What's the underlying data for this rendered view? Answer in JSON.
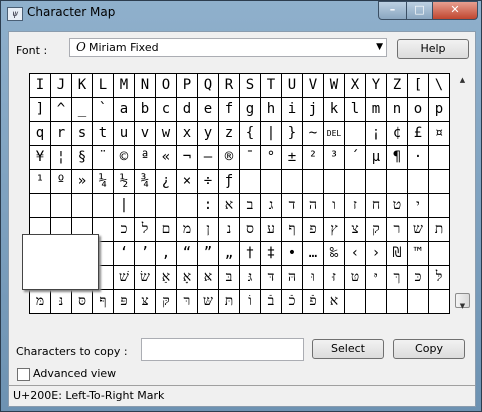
{
  "window": {
    "title": "Character Map",
    "app_icon_glyph": "ψ"
  },
  "title_buttons": {
    "minimize": "–",
    "maximize": "□",
    "close": "✕"
  },
  "font": {
    "label": "Font :",
    "glyph": "O",
    "value": "Miriam Fixed",
    "arrow": "▼"
  },
  "buttons": {
    "help": "Help",
    "select": "Select",
    "copy": "Copy"
  },
  "grid_rows": [
    [
      "I",
      "J",
      "K",
      "L",
      "M",
      "N",
      "O",
      "P",
      "Q",
      "R",
      "S",
      "T",
      "U",
      "V",
      "W",
      "X",
      "Y",
      "Z",
      "[",
      "\\"
    ],
    [
      "]",
      "^",
      "_",
      "`",
      "a",
      "b",
      "c",
      "d",
      "e",
      "f",
      "g",
      "h",
      "i",
      "j",
      "k",
      "l",
      "m",
      "n",
      "o",
      "p"
    ],
    [
      "q",
      "r",
      "s",
      "t",
      "u",
      "v",
      "w",
      "x",
      "y",
      "z",
      "{",
      "|",
      "}",
      "~",
      "DEL",
      "",
      "¡",
      "¢",
      "£",
      "¤"
    ],
    [
      "¥",
      "¦",
      "§",
      "¨",
      "©",
      "ª",
      "«",
      "¬",
      "–",
      "®",
      "¯",
      "°",
      "±",
      "²",
      "³",
      "´",
      "µ",
      "¶",
      "·",
      ""
    ],
    [
      "¹",
      "º",
      "»",
      "¼",
      "½",
      "¾",
      "¿",
      "×",
      "÷",
      "ƒ",
      "",
      "",
      "",
      "",
      "",
      "",
      "",
      "",
      "",
      ""
    ],
    [
      "",
      "",
      "",
      "",
      "|",
      "",
      "",
      "",
      ":",
      "א",
      "ב",
      "ג",
      "ד",
      "ה",
      "ו",
      "ז",
      "ח",
      "ט",
      "י",
      ""
    ],
    [
      "",
      "",
      "",
      "",
      "כ",
      "ל",
      "ם",
      "מ",
      "ן",
      "נ",
      "ס",
      "ע",
      "ף",
      "פ",
      "ץ",
      "צ",
      "ק",
      "ר",
      "ש",
      "ת"
    ],
    [
      "",
      "",
      "",
      "",
      "‘",
      "’",
      "‚",
      "“",
      "”",
      "„",
      "†",
      "‡",
      "•",
      "…",
      "‰",
      "‹",
      "›",
      "₪",
      "™",
      ""
    ],
    [
      "",
      "",
      "",
      "",
      "שׁ",
      "שׂ",
      "אַ",
      "אָ",
      "אּ",
      "בּ",
      "גּ",
      "דּ",
      "הּ",
      "וּ",
      "זּ",
      "טּ",
      "יּ",
      "ךּ",
      "כּ",
      "לּ"
    ],
    [
      "מּ",
      "נּ",
      "סּ",
      "ףּ",
      "פּ",
      "צּ",
      "קּ",
      "רּ",
      "שּ",
      "תּ",
      "וֹ",
      "בֿ",
      "כֿ",
      "פֿ",
      "א",
      "",
      "",
      "",
      "",
      ""
    ]
  ],
  "copy": {
    "label": "Characters to copy :",
    "value": ""
  },
  "advanced": {
    "label": "Advanced view",
    "checked": false
  },
  "status": {
    "text": "U+200E: Left-To-Right Mark"
  },
  "scroll": {
    "up_arrow": "▲",
    "down_arrow": "▼"
  }
}
